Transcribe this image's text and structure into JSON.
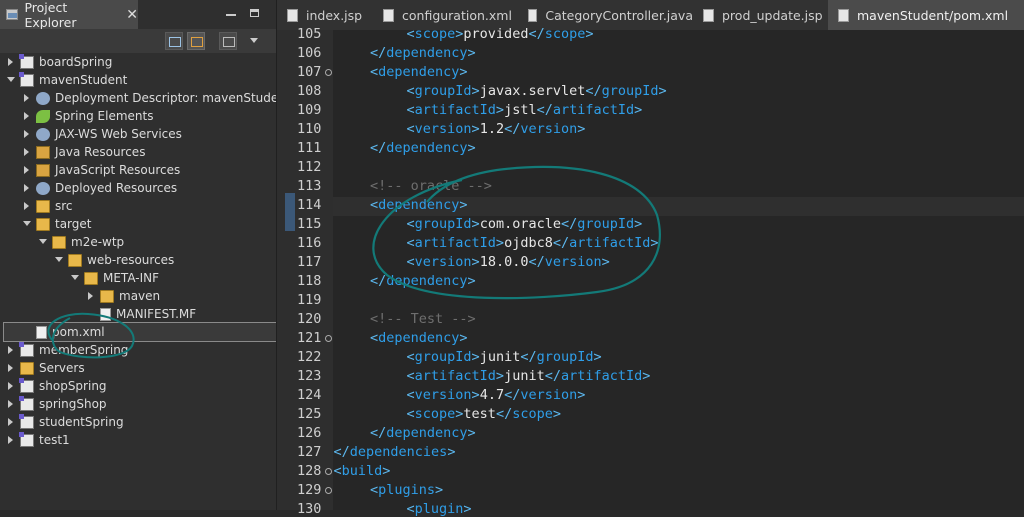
{
  "explorer": {
    "title": "Project Explorer",
    "tree": [
      {
        "label": "boardSpring",
        "depth": 0,
        "arrow": "closed",
        "icon": "project"
      },
      {
        "label": "mavenStudent",
        "depth": 0,
        "arrow": "open",
        "icon": "project"
      },
      {
        "label": "Deployment Descriptor: mavenStudent",
        "depth": 1,
        "arrow": "closed",
        "icon": "gear"
      },
      {
        "label": "Spring Elements",
        "depth": 1,
        "arrow": "closed",
        "icon": "leaf"
      },
      {
        "label": "JAX-WS Web Services",
        "depth": 1,
        "arrow": "closed",
        "icon": "gear"
      },
      {
        "label": "Java Resources",
        "depth": 1,
        "arrow": "closed",
        "icon": "pkg"
      },
      {
        "label": "JavaScript Resources",
        "depth": 1,
        "arrow": "closed",
        "icon": "pkg"
      },
      {
        "label": "Deployed Resources",
        "depth": 1,
        "arrow": "closed",
        "icon": "gear"
      },
      {
        "label": "src",
        "depth": 1,
        "arrow": "closed",
        "icon": "folder"
      },
      {
        "label": "target",
        "depth": 1,
        "arrow": "open",
        "icon": "folder"
      },
      {
        "label": "m2e-wtp",
        "depth": 2,
        "arrow": "open",
        "icon": "folder"
      },
      {
        "label": "web-resources",
        "depth": 3,
        "arrow": "open",
        "icon": "folder"
      },
      {
        "label": "META-INF",
        "depth": 4,
        "arrow": "open",
        "icon": "folder"
      },
      {
        "label": "maven",
        "depth": 5,
        "arrow": "closed",
        "icon": "folder"
      },
      {
        "label": "MANIFEST.MF",
        "depth": 5,
        "arrow": "none",
        "icon": "file"
      },
      {
        "label": "pom.xml",
        "depth": 1,
        "arrow": "none",
        "icon": "file",
        "selected": true
      },
      {
        "label": "memberSpring",
        "depth": 0,
        "arrow": "closed",
        "icon": "project"
      },
      {
        "label": "Servers",
        "depth": 0,
        "arrow": "closed",
        "icon": "folder"
      },
      {
        "label": "shopSpring",
        "depth": 0,
        "arrow": "closed",
        "icon": "project"
      },
      {
        "label": "springShop",
        "depth": 0,
        "arrow": "closed",
        "icon": "project"
      },
      {
        "label": "studentSpring",
        "depth": 0,
        "arrow": "closed",
        "icon": "project"
      },
      {
        "label": "test1",
        "depth": 0,
        "arrow": "closed",
        "icon": "project"
      }
    ]
  },
  "tabs": [
    {
      "label": "index.jsp"
    },
    {
      "label": "configuration.xml"
    },
    {
      "label": "CategoryController.java"
    },
    {
      "label": "prod_update.jsp"
    },
    {
      "label": "mavenStudent/pom.xml",
      "active": true
    }
  ],
  "code_lines": [
    {
      "n": "105",
      "fold": false,
      "indent": 3,
      "tokens": [
        [
          "b",
          "<"
        ],
        [
          "t",
          "scope"
        ],
        [
          "b",
          ">"
        ],
        [
          "txt",
          "provided"
        ],
        [
          "b",
          "</"
        ],
        [
          "t",
          "scope"
        ],
        [
          "b",
          ">"
        ]
      ]
    },
    {
      "n": "106",
      "fold": false,
      "indent": 2,
      "tokens": [
        [
          "b",
          "</"
        ],
        [
          "t",
          "dependency"
        ],
        [
          "b",
          ">"
        ]
      ]
    },
    {
      "n": "107",
      "fold": true,
      "indent": 2,
      "tokens": [
        [
          "b",
          "<"
        ],
        [
          "t",
          "dependency"
        ],
        [
          "b",
          ">"
        ]
      ]
    },
    {
      "n": "108",
      "fold": false,
      "indent": 3,
      "tokens": [
        [
          "b",
          "<"
        ],
        [
          "t",
          "groupId"
        ],
        [
          "b",
          ">"
        ],
        [
          "txt",
          "javax.servlet"
        ],
        [
          "b",
          "</"
        ],
        [
          "t",
          "groupId"
        ],
        [
          "b",
          ">"
        ]
      ]
    },
    {
      "n": "109",
      "fold": false,
      "indent": 3,
      "tokens": [
        [
          "b",
          "<"
        ],
        [
          "t",
          "artifactId"
        ],
        [
          "b",
          ">"
        ],
        [
          "txt",
          "jstl"
        ],
        [
          "b",
          "</"
        ],
        [
          "t",
          "artifactId"
        ],
        [
          "b",
          ">"
        ]
      ]
    },
    {
      "n": "110",
      "fold": false,
      "indent": 3,
      "tokens": [
        [
          "b",
          "<"
        ],
        [
          "t",
          "version"
        ],
        [
          "b",
          ">"
        ],
        [
          "txt",
          "1.2"
        ],
        [
          "b",
          "</"
        ],
        [
          "t",
          "version"
        ],
        [
          "b",
          ">"
        ]
      ]
    },
    {
      "n": "111",
      "fold": false,
      "indent": 2,
      "tokens": [
        [
          "b",
          "</"
        ],
        [
          "t",
          "dependency"
        ],
        [
          "b",
          ">"
        ]
      ]
    },
    {
      "n": "112",
      "fold": false,
      "indent": 0,
      "tokens": []
    },
    {
      "n": "113",
      "fold": false,
      "indent": 2,
      "tokens": [
        [
          "cm",
          "<!-- oracle -->"
        ]
      ]
    },
    {
      "n": "114",
      "fold": false,
      "indent": 2,
      "current": true,
      "tokens": [
        [
          "b",
          "<"
        ],
        [
          "t",
          "dependency"
        ],
        [
          "b",
          ">"
        ]
      ]
    },
    {
      "n": "115",
      "fold": false,
      "indent": 3,
      "tokens": [
        [
          "b",
          "<"
        ],
        [
          "t",
          "groupId"
        ],
        [
          "b",
          ">"
        ],
        [
          "txt",
          "com.oracle"
        ],
        [
          "b",
          "</"
        ],
        [
          "t",
          "groupId"
        ],
        [
          "b",
          ">"
        ]
      ]
    },
    {
      "n": "116",
      "fold": false,
      "indent": 3,
      "tokens": [
        [
          "b",
          "<"
        ],
        [
          "t",
          "artifactId"
        ],
        [
          "b",
          ">"
        ],
        [
          "txt",
          "ojdbc8"
        ],
        [
          "b",
          "</"
        ],
        [
          "t",
          "artifactId"
        ],
        [
          "b",
          ">"
        ]
      ]
    },
    {
      "n": "117",
      "fold": false,
      "indent": 3,
      "tokens": [
        [
          "b",
          "<"
        ],
        [
          "t",
          "version"
        ],
        [
          "b",
          ">"
        ],
        [
          "txt",
          "18.0.0"
        ],
        [
          "b",
          "</"
        ],
        [
          "t",
          "version"
        ],
        [
          "b",
          ">"
        ]
      ]
    },
    {
      "n": "118",
      "fold": false,
      "indent": 2,
      "tokens": [
        [
          "b",
          "</"
        ],
        [
          "t",
          "dependency"
        ],
        [
          "b",
          ">"
        ]
      ]
    },
    {
      "n": "119",
      "fold": false,
      "indent": 0,
      "tokens": []
    },
    {
      "n": "120",
      "fold": false,
      "indent": 2,
      "tokens": [
        [
          "cm",
          "<!-- Test -->"
        ]
      ]
    },
    {
      "n": "121",
      "fold": true,
      "indent": 2,
      "tokens": [
        [
          "b",
          "<"
        ],
        [
          "t",
          "dependency"
        ],
        [
          "b",
          ">"
        ]
      ]
    },
    {
      "n": "122",
      "fold": false,
      "indent": 3,
      "tokens": [
        [
          "b",
          "<"
        ],
        [
          "t",
          "groupId"
        ],
        [
          "b",
          ">"
        ],
        [
          "txt",
          "junit"
        ],
        [
          "b",
          "</"
        ],
        [
          "t",
          "groupId"
        ],
        [
          "b",
          ">"
        ]
      ]
    },
    {
      "n": "123",
      "fold": false,
      "indent": 3,
      "tokens": [
        [
          "b",
          "<"
        ],
        [
          "t",
          "artifactId"
        ],
        [
          "b",
          ">"
        ],
        [
          "txt",
          "junit"
        ],
        [
          "b",
          "</"
        ],
        [
          "t",
          "artifactId"
        ],
        [
          "b",
          ">"
        ]
      ]
    },
    {
      "n": "124",
      "fold": false,
      "indent": 3,
      "tokens": [
        [
          "b",
          "<"
        ],
        [
          "t",
          "version"
        ],
        [
          "b",
          ">"
        ],
        [
          "txt",
          "4.7"
        ],
        [
          "b",
          "</"
        ],
        [
          "t",
          "version"
        ],
        [
          "b",
          ">"
        ]
      ]
    },
    {
      "n": "125",
      "fold": false,
      "indent": 3,
      "tokens": [
        [
          "b",
          "<"
        ],
        [
          "t",
          "scope"
        ],
        [
          "b",
          ">"
        ],
        [
          "txt",
          "test"
        ],
        [
          "b",
          "</"
        ],
        [
          "t",
          "scope"
        ],
        [
          "b",
          ">"
        ]
      ]
    },
    {
      "n": "126",
      "fold": false,
      "indent": 2,
      "tokens": [
        [
          "b",
          "</"
        ],
        [
          "t",
          "dependency"
        ],
        [
          "b",
          ">"
        ]
      ]
    },
    {
      "n": "127",
      "fold": false,
      "indent": 1,
      "tokens": [
        [
          "b",
          "</"
        ],
        [
          "t",
          "dependencies"
        ],
        [
          "b",
          ">"
        ]
      ]
    },
    {
      "n": "128",
      "fold": true,
      "indent": 1,
      "tokens": [
        [
          "b",
          "<"
        ],
        [
          "t",
          "build"
        ],
        [
          "b",
          ">"
        ]
      ]
    },
    {
      "n": "129",
      "fold": true,
      "indent": 2,
      "tokens": [
        [
          "b",
          "<"
        ],
        [
          "t",
          "plugins"
        ],
        [
          "b",
          ">"
        ]
      ]
    },
    {
      "n": "130",
      "fold": false,
      "indent": 3,
      "tokens": [
        [
          "b",
          "<"
        ],
        [
          "t",
          "plugin"
        ],
        [
          "b",
          ">"
        ]
      ]
    }
  ],
  "colors": {
    "tag": "#2f9ee8",
    "bracket": "#5cb8ef",
    "comment": "#6e6e6e",
    "annotation": "#137a78"
  }
}
